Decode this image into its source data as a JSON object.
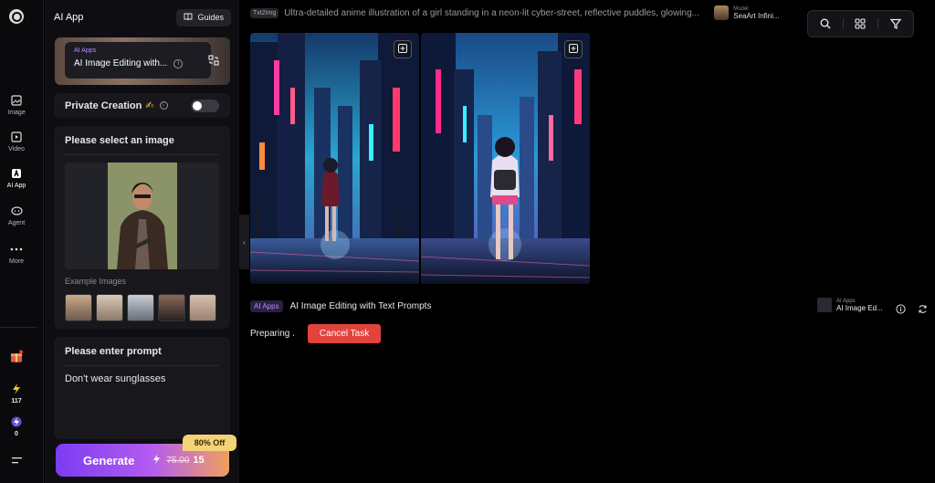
{
  "rail": {
    "items": [
      {
        "label": "Image",
        "icon": "image-icon"
      },
      {
        "label": "Video",
        "icon": "video-icon"
      },
      {
        "label": "AI App",
        "icon": "ai-app-icon"
      },
      {
        "label": "Agent",
        "icon": "agent-icon"
      },
      {
        "label": "More",
        "icon": "more-icon"
      }
    ],
    "credits_lightning": "117",
    "credits_bolt": "0"
  },
  "panel": {
    "title": "AI App",
    "guides_label": "Guides",
    "app_tag": "AI Apps",
    "app_name": "AI Image Editing with...",
    "private_label": "Private Creation",
    "private_emoji": "✍",
    "select_title": "Please select an image",
    "example_label": "Example Images",
    "prompt_title": "Please enter prompt",
    "prompt_value": "Don't wear sunglasses",
    "generate_label": "Generate",
    "price_old": "75.00",
    "price_new": "15",
    "discount": "80% Off"
  },
  "main": {
    "tag": "Txt2Img",
    "prompt": "Ultra-detailed anime illustration of a girl standing in a neon-lit cyber-street, reflective puddles, glowing...",
    "model_label": "Model",
    "model_name": "SeaArt Infini...",
    "task_tag": "AI Apps",
    "task_title": "AI Image Editing with Text Prompts",
    "preparing": "Preparing .",
    "cancel_label": "Cancel Task",
    "side_tag": "AI Apps",
    "side_name": "AI Image Ed..."
  },
  "colors": {
    "accent": "#7b3cf2",
    "cancel": "#e0443c",
    "discount": "#f4d27a",
    "tag_purple": "#b68cff"
  }
}
